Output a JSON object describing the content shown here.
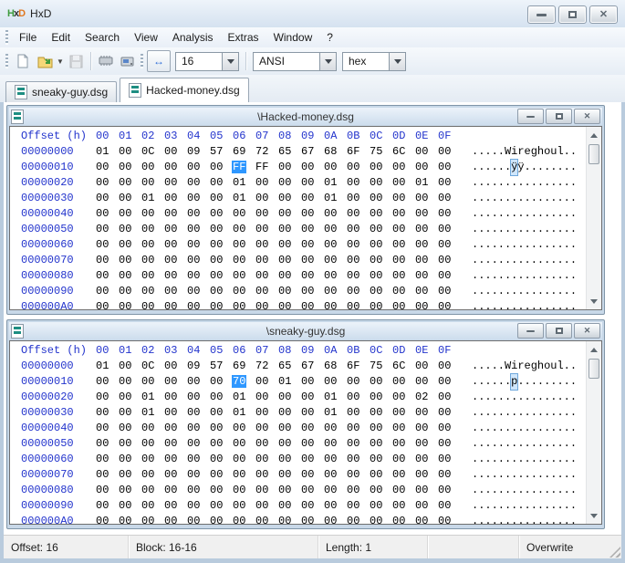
{
  "app": {
    "title": "HxD"
  },
  "menu": {
    "items": [
      "File",
      "Edit",
      "Search",
      "View",
      "Analysis",
      "Extras",
      "Window",
      "?"
    ]
  },
  "toolbar": {
    "bytes_per_row": "16",
    "encoding": "ANSI",
    "offset_base": "hex",
    "icons": [
      "new-file",
      "open-file",
      "open-dropdown",
      "save",
      "ram-chip",
      "open-disk",
      "bytes-per-row"
    ]
  },
  "tabs": [
    {
      "label": "sneaky-guy.dsg",
      "active": false
    },
    {
      "label": "Hacked-money.dsg",
      "active": true
    }
  ],
  "hex_header": {
    "offset_label": "Offset (h)",
    "columns": [
      "00",
      "01",
      "02",
      "03",
      "04",
      "05",
      "06",
      "07",
      "08",
      "09",
      "0A",
      "0B",
      "0C",
      "0D",
      "0E",
      "0F"
    ]
  },
  "editors": [
    {
      "title": "\\Hacked-money.dsg",
      "selection": {
        "row": 1,
        "col": 6
      },
      "rows": [
        {
          "offset": "00000000",
          "bytes": "01 00 0C 00 09 57 69 72 65 67 68 6F 75 6C 00 00",
          "ascii": ".....Wireghoul.."
        },
        {
          "offset": "00000010",
          "bytes": "00 00 00 00 00 00 FF FF 00 00 00 00 00 00 00 00",
          "ascii": "......ÿÿ........"
        },
        {
          "offset": "00000020",
          "bytes": "00 00 00 00 00 00 01 00 00 00 01 00 00 00 01 00",
          "ascii": "................"
        },
        {
          "offset": "00000030",
          "bytes": "00 00 01 00 00 00 01 00 00 00 01 00 00 00 00 00",
          "ascii": "................"
        },
        {
          "offset": "00000040",
          "bytes": "00 00 00 00 00 00 00 00 00 00 00 00 00 00 00 00",
          "ascii": "................"
        },
        {
          "offset": "00000050",
          "bytes": "00 00 00 00 00 00 00 00 00 00 00 00 00 00 00 00",
          "ascii": "................"
        },
        {
          "offset": "00000060",
          "bytes": "00 00 00 00 00 00 00 00 00 00 00 00 00 00 00 00",
          "ascii": "................"
        },
        {
          "offset": "00000070",
          "bytes": "00 00 00 00 00 00 00 00 00 00 00 00 00 00 00 00",
          "ascii": "................"
        },
        {
          "offset": "00000080",
          "bytes": "00 00 00 00 00 00 00 00 00 00 00 00 00 00 00 00",
          "ascii": "................"
        },
        {
          "offset": "00000090",
          "bytes": "00 00 00 00 00 00 00 00 00 00 00 00 00 00 00 00",
          "ascii": "................"
        },
        {
          "offset": "000000A0",
          "bytes": "00 00 00 00 00 00 00 00 00 00 00 00 00 00 00 00",
          "ascii": "................"
        }
      ]
    },
    {
      "title": "\\sneaky-guy.dsg",
      "selection": {
        "row": 1,
        "col": 6
      },
      "rows": [
        {
          "offset": "00000000",
          "bytes": "01 00 0C 00 09 57 69 72 65 67 68 6F 75 6C 00 00",
          "ascii": ".....Wireghoul.."
        },
        {
          "offset": "00000010",
          "bytes": "00 00 00 00 00 00 70 00 01 00 00 00 00 00 00 00",
          "ascii": "......p........."
        },
        {
          "offset": "00000020",
          "bytes": "00 00 01 00 00 00 01 00 00 00 01 00 00 00 02 00",
          "ascii": "................"
        },
        {
          "offset": "00000030",
          "bytes": "00 00 01 00 00 00 01 00 00 00 01 00 00 00 00 00",
          "ascii": "................"
        },
        {
          "offset": "00000040",
          "bytes": "00 00 00 00 00 00 00 00 00 00 00 00 00 00 00 00",
          "ascii": "................"
        },
        {
          "offset": "00000050",
          "bytes": "00 00 00 00 00 00 00 00 00 00 00 00 00 00 00 00",
          "ascii": "................"
        },
        {
          "offset": "00000060",
          "bytes": "00 00 00 00 00 00 00 00 00 00 00 00 00 00 00 00",
          "ascii": "................"
        },
        {
          "offset": "00000070",
          "bytes": "00 00 00 00 00 00 00 00 00 00 00 00 00 00 00 00",
          "ascii": "................"
        },
        {
          "offset": "00000080",
          "bytes": "00 00 00 00 00 00 00 00 00 00 00 00 00 00 00 00",
          "ascii": "................"
        },
        {
          "offset": "00000090",
          "bytes": "00 00 00 00 00 00 00 00 00 00 00 00 00 00 00 00",
          "ascii": "................"
        },
        {
          "offset": "000000A0",
          "bytes": "00 00 00 00 00 00 00 00 00 00 00 00 00 00 00 00",
          "ascii": "................"
        }
      ]
    }
  ],
  "statusbar": {
    "offset": "Offset: 16",
    "block": "Block: 16-16",
    "length": "Length: 1",
    "spare": "",
    "mode": "Overwrite"
  },
  "colors": {
    "selection_fill": "#2e97ff",
    "selection_text": "#ffffff",
    "ascii_selection_fill": "#cfe6fb",
    "ascii_selection_border": "#6fa8dc",
    "offset_text": "#2233cc",
    "frame": "#b9cbdd"
  }
}
